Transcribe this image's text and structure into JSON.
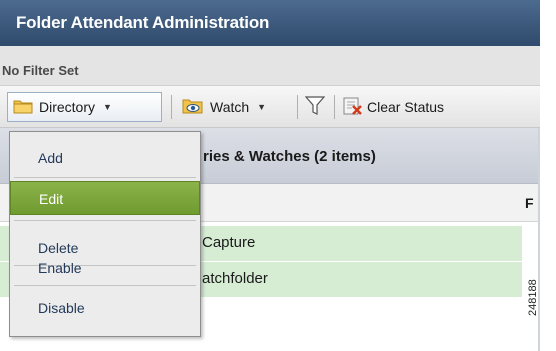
{
  "app": {
    "title": "Folder Attendant Administration"
  },
  "filter": {
    "status": "No Filter Set"
  },
  "toolbar": {
    "directory_label": "Directory",
    "watch_label": "Watch",
    "clear_status_label": "Clear Status"
  },
  "list": {
    "header": "ries & Watches (2 items)",
    "col_p": "F",
    "rows": [
      {
        "name": "Capture"
      },
      {
        "name": "atchfolder"
      }
    ]
  },
  "menu": {
    "items": [
      {
        "label": "Add"
      },
      {
        "label": "Edit"
      },
      {
        "label": "Delete"
      },
      {
        "label": "Enable"
      },
      {
        "label": "Disable"
      }
    ],
    "active_item": "Edit"
  },
  "figure": {
    "id": "248188"
  },
  "colors": {
    "title_bar": "#2e4a6c",
    "row_bg": "#d6edd4",
    "menu_active": "#7aa63a"
  },
  "icons": [
    "folder-icon",
    "watch-folder-icon",
    "filter-icon",
    "clear-status-icon",
    "chevron-down-icon"
  ]
}
